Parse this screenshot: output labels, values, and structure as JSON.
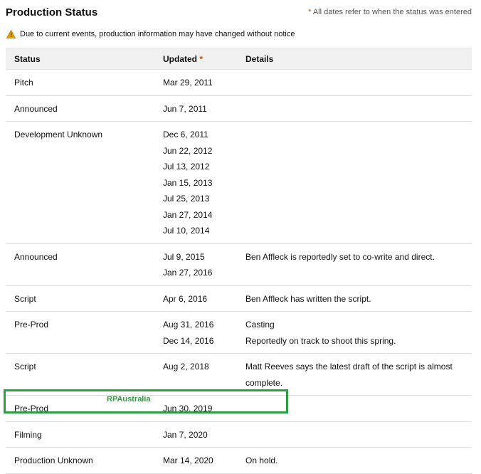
{
  "header": {
    "title": "Production Status",
    "note_star": "*",
    "note": "All dates refer to when the status was entered"
  },
  "warning": {
    "icon": "warning-icon",
    "text": "Due to current events, production information may have changed without notice"
  },
  "table": {
    "columns": {
      "status": "Status",
      "updated": "Updated",
      "updated_star": "*",
      "details": "Details"
    },
    "rows": [
      {
        "status": "Pitch",
        "dates": [
          "Mar 29, 2011"
        ],
        "details": []
      },
      {
        "status": "Announced",
        "dates": [
          "Jun 7, 2011"
        ],
        "details": []
      },
      {
        "status": "Development Unknown",
        "dates": [
          "Dec 6, 2011",
          "Jun 22, 2012",
          "Jul 13, 2012",
          "Jan 15, 2013",
          "Jul 25, 2013",
          "Jan 27, 2014",
          "Jul 10, 2014"
        ],
        "details": []
      },
      {
        "status": "Announced",
        "dates": [
          "Jul 9, 2015",
          "Jan 27, 2016"
        ],
        "details": [
          "Ben Affleck is reportedly set to co-write and direct."
        ]
      },
      {
        "status": "Script",
        "dates": [
          "Apr 6, 2016"
        ],
        "details": [
          "Ben Affleck has written the script."
        ]
      },
      {
        "status": "Pre-Prod",
        "dates": [
          "Aug 31, 2016",
          "Dec 14, 2016"
        ],
        "details": [
          "Casting",
          "Reportedly on track to shoot this spring."
        ]
      },
      {
        "status": "Script",
        "dates": [
          "Aug 2, 2018"
        ],
        "details": [
          "Matt Reeves says the latest draft of the script is almost complete."
        ]
      },
      {
        "status": "Pre-Prod",
        "dates": [
          "Jun 30, 2019"
        ],
        "details": []
      },
      {
        "status": "Filming",
        "dates": [
          "Jan 7, 2020"
        ],
        "details": []
      },
      {
        "status": "Production Unknown",
        "dates": [
          "Mar 14, 2020"
        ],
        "details": [
          "On hold."
        ]
      }
    ]
  },
  "watermark": "RPAustralia",
  "colors": {
    "accent_star": "#c45500",
    "highlight": "#2e9e44",
    "header_bg": "#f0f0f0"
  }
}
